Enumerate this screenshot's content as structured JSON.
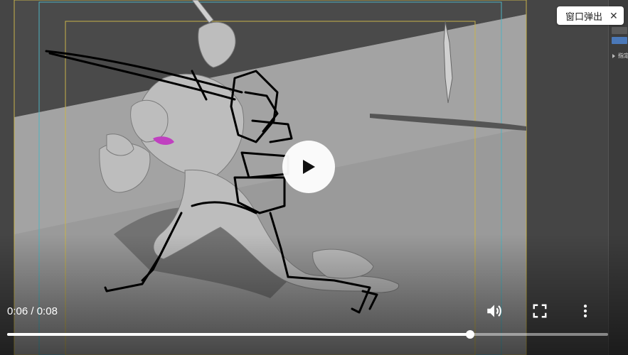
{
  "player": {
    "popout_label": "窗口弹出",
    "current_time": "0:06",
    "duration": "0:08",
    "time_separator": " / ",
    "progress_fraction": 0.77
  },
  "side_panel": {
    "row_label": "指定"
  },
  "icons": {
    "play": "play-icon",
    "volume": "volume-icon",
    "fullscreen": "fullscreen-icon",
    "more": "more-vertical-icon",
    "close": "close-icon"
  }
}
